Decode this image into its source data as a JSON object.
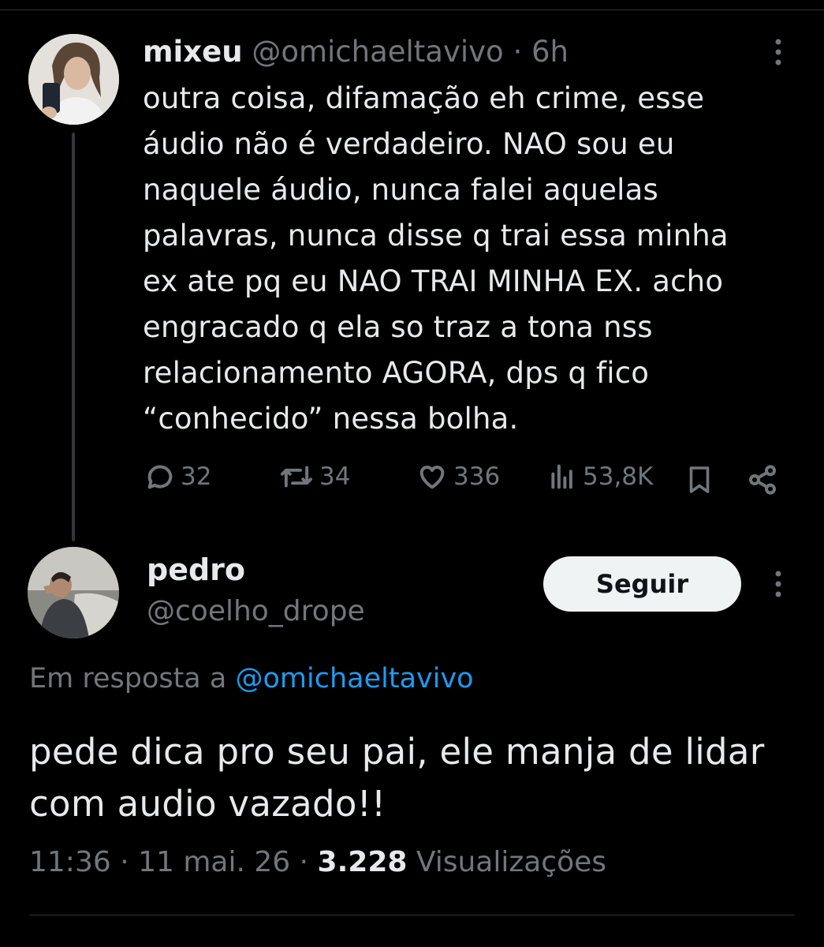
{
  "tweet": {
    "display_name": "mixeu",
    "handle": "@omichaeltavivo",
    "separator": "·",
    "time": "6h",
    "text": "outra coisa, difamação eh crime, esse\náudio não é verdadeiro. NAO sou eu\nnaquele áudio, nunca falei aquelas\npalavras, nunca disse q trai essa minha\nex ate pq eu NAO TRAI MINHA EX. acho\nengracado q ela so traz a tona nss\nrelacionamento AGORA, dps q fico\n“conhecido” nessa bolha.",
    "replies": "32",
    "reposts": "34",
    "likes": "336",
    "views": "53,8K"
  },
  "reply": {
    "display_name": "pedro",
    "handle": "@coelho_drope",
    "follow_label": "Seguir",
    "reply_prefix": "Em resposta a",
    "reply_to_handle": "@omichaeltavivo",
    "text": "pede dica pro seu pai, ele manja de lidar\ncom audio vazado!!",
    "time": "11:36",
    "sep1": "·",
    "date": "11 mai. 26",
    "sep2": "·",
    "views_count": "3.228",
    "views_label": "Visualizações"
  },
  "colors": {
    "background": "#000000",
    "text": "#e7e9ea",
    "muted": "#71767b",
    "link": "#1d9bf0",
    "button_bg": "#eff3f4"
  },
  "icons": [
    "more-icon",
    "reply-icon",
    "repost-icon",
    "like-icon",
    "views-icon",
    "bookmark-icon",
    "share-icon"
  ]
}
